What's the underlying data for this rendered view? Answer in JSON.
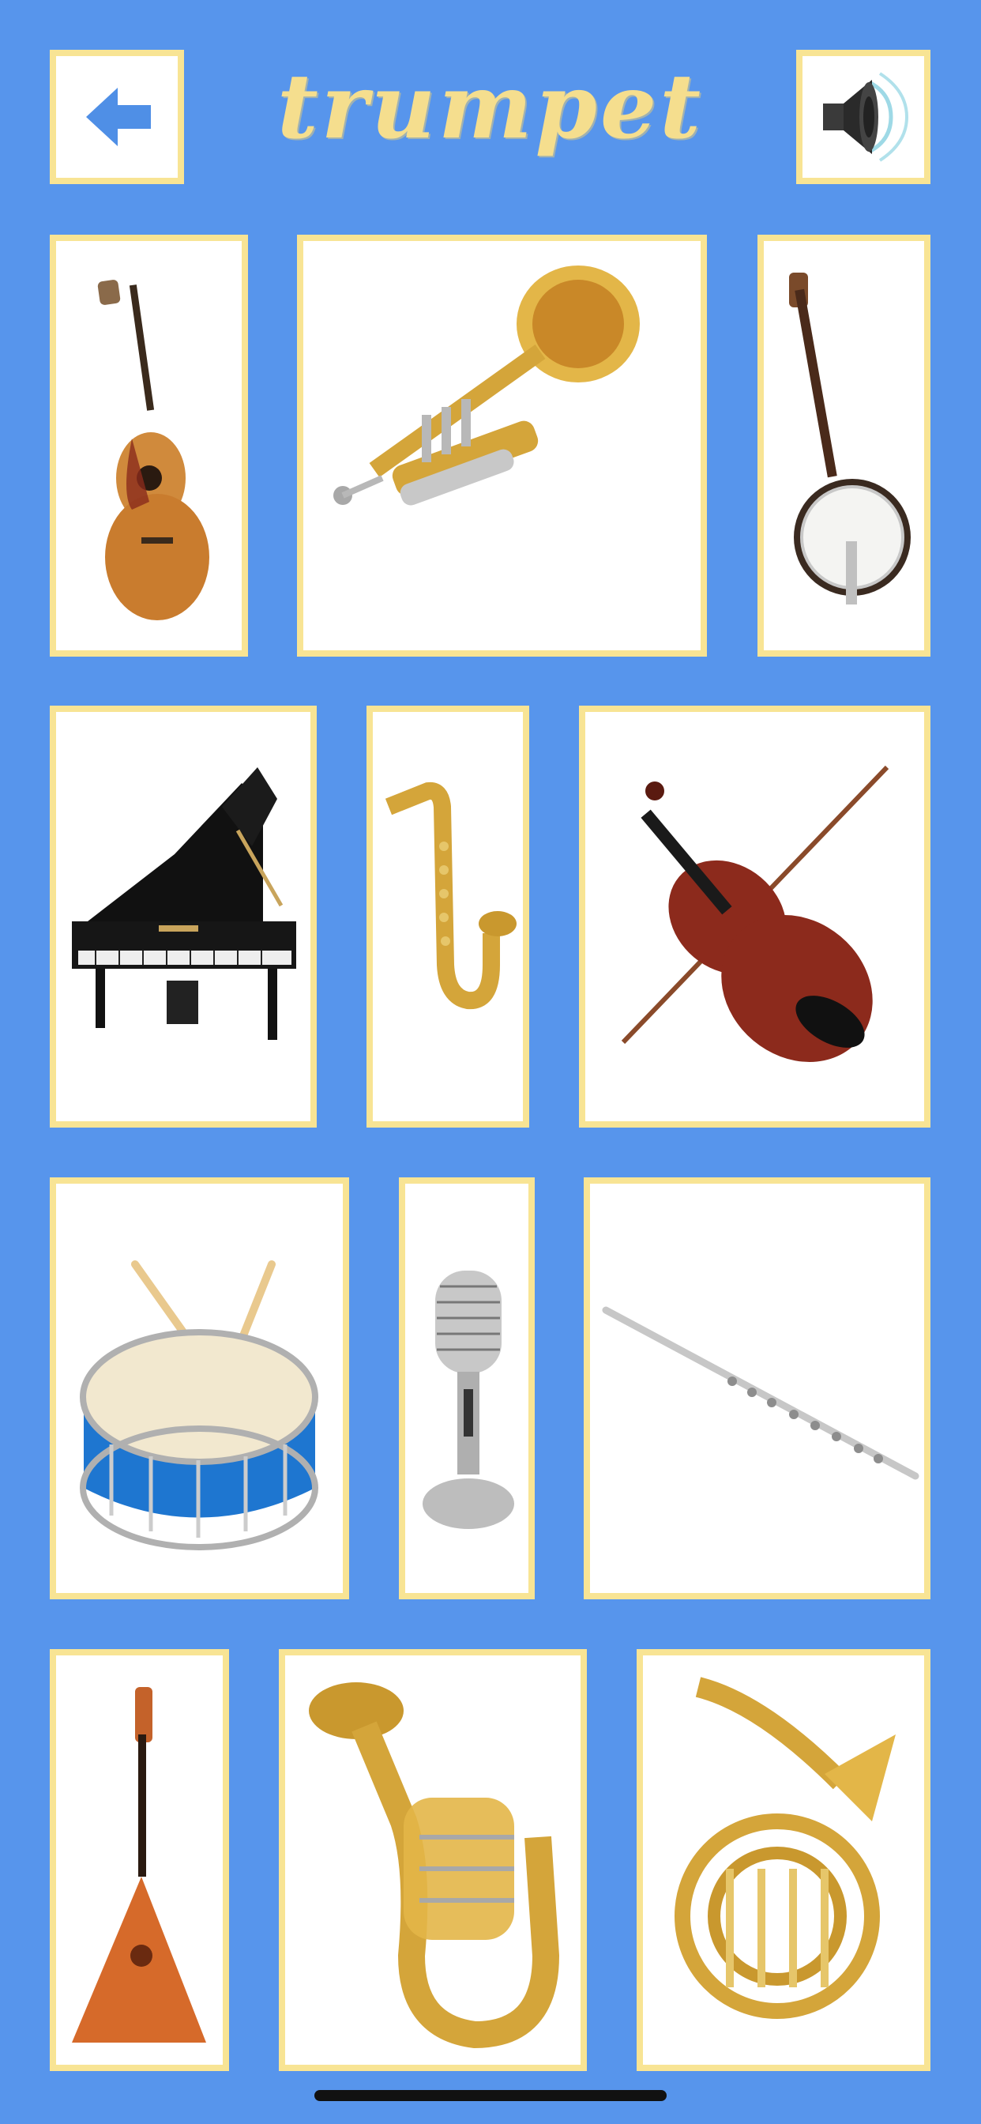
{
  "header": {
    "title": "trumpet",
    "back_icon": "left-arrow-icon",
    "sound_icon": "speaker-icon"
  },
  "colors": {
    "background": "#5795EC",
    "tile_border": "#F8E494",
    "title_text": "#F5DE8E",
    "arrow": "#4F8FE6"
  },
  "instruments": [
    {
      "icon": "guitar-icon"
    },
    {
      "icon": "trumpet-icon"
    },
    {
      "icon": "banjo-icon"
    },
    {
      "icon": "grand-piano-icon"
    },
    {
      "icon": "saxophone-icon"
    },
    {
      "icon": "violin-icon"
    },
    {
      "icon": "drum-icon"
    },
    {
      "icon": "microphone-icon"
    },
    {
      "icon": "flute-icon"
    },
    {
      "icon": "balalaika-icon"
    },
    {
      "icon": "tuba-icon"
    },
    {
      "icon": "french-horn-icon"
    }
  ]
}
